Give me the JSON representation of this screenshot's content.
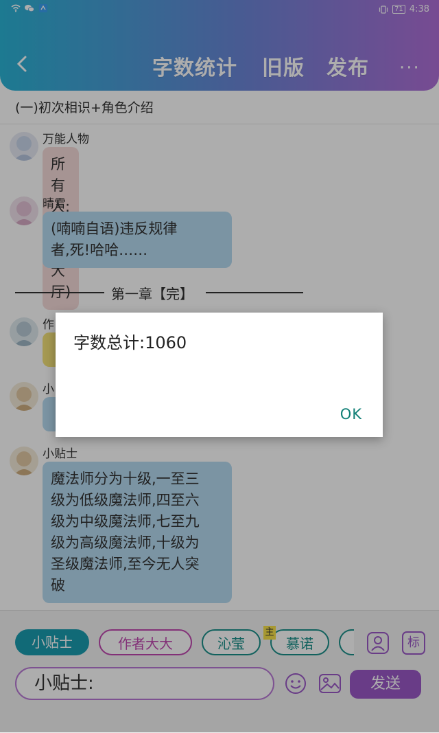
{
  "status_bar": {
    "battery": "71",
    "time": "4:38"
  },
  "header": {
    "title": "字数统计",
    "old_version": "旧版",
    "publish": "发布",
    "more": "···"
  },
  "chapter_title": "(一)初次相识+角色介绍",
  "messages": [
    {
      "name": "万能人物",
      "text": "所有人:(走出大厅)",
      "bubble_color": "#f5dad9"
    },
    {
      "name": "晴雪",
      "text_lines": [
        "(喃喃自语)违反规律",
        "者,死!哈哈……"
      ],
      "bubble_color": "#b5daf1"
    },
    {
      "separator": "第一章【完】"
    },
    {
      "name": "作"
    },
    {
      "name": "小"
    },
    {
      "name": "小贴士",
      "text_lines": [
        "魔法师分为十级,一至三",
        "级为低级魔法师,四至六",
        "级为中级魔法师,七至九",
        "级为高级魔法师,十级为",
        "圣级魔法师,至今无人突",
        "破"
      ],
      "bubble_color": "#b5daf1"
    }
  ],
  "role_chips": [
    {
      "label": "小贴士",
      "color": "#1a9cb0"
    },
    {
      "label": "作者大大",
      "color": "#c048b0"
    },
    {
      "label": "沁莹",
      "color": "#1a8f8a"
    },
    {
      "label": "慕诺",
      "color": "#1a8f8a",
      "badge": "主"
    }
  ],
  "side_buttons": {
    "label_tag": "标"
  },
  "input": {
    "value": "小贴士:"
  },
  "send_label": "发送",
  "dialog": {
    "message": "字数总计:1060",
    "ok_label": "OK"
  }
}
